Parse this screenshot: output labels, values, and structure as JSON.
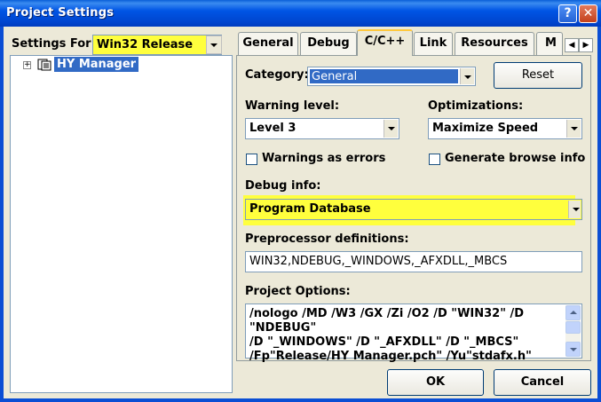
{
  "window": {
    "title": "Project Settings",
    "help_glyph": "?",
    "close_glyph": "✕"
  },
  "left": {
    "settings_for_label": "Settings For:",
    "settings_for_value": "Win32 Release",
    "tree_root": "HY Manager",
    "tree_expand_glyph": "+"
  },
  "tabs": [
    {
      "label": "General",
      "active": false
    },
    {
      "label": "Debug",
      "active": false
    },
    {
      "label": "C/C++",
      "active": true
    },
    {
      "label": "Link",
      "active": false
    },
    {
      "label": "Resources",
      "active": false
    },
    {
      "label": "M",
      "active": false
    }
  ],
  "tab_scroll": {
    "left": "◀",
    "right": "▶"
  },
  "cpp": {
    "category_label": "Category:",
    "category_value": "General",
    "reset_label": "Reset",
    "warning_level_label": "Warning level:",
    "warning_level_value": "Level 3",
    "optimizations_label": "Optimizations:",
    "optimizations_value": "Maximize Speed",
    "warnings_as_errors_label": "Warnings as errors",
    "warnings_as_errors_checked": false,
    "generate_browse_label": "Generate browse info",
    "generate_browse_checked": false,
    "debug_info_label": "Debug info:",
    "debug_info_value": "Program Database",
    "preprocessor_label": "Preprocessor definitions:",
    "preprocessor_value": "WIN32,NDEBUG,_WINDOWS,_AFXDLL,_MBCS",
    "project_options_label": "Project Options:",
    "project_options_lines": [
      "/nologo /MD /W3 /GX /Zi /O2 /D \"WIN32\" /D \"NDEBUG\"",
      "/D \"_WINDOWS\" /D \"_AFXDLL\" /D \"_MBCS\"",
      "/Fp\"Release/HY Manager.pch\" /Yu\"stdafx.h\""
    ]
  },
  "footer": {
    "ok_label": "OK",
    "cancel_label": "Cancel"
  },
  "colors": {
    "highlight": "#ffff3d",
    "selection": "#316ac5",
    "titlebar": "#0055e5"
  }
}
